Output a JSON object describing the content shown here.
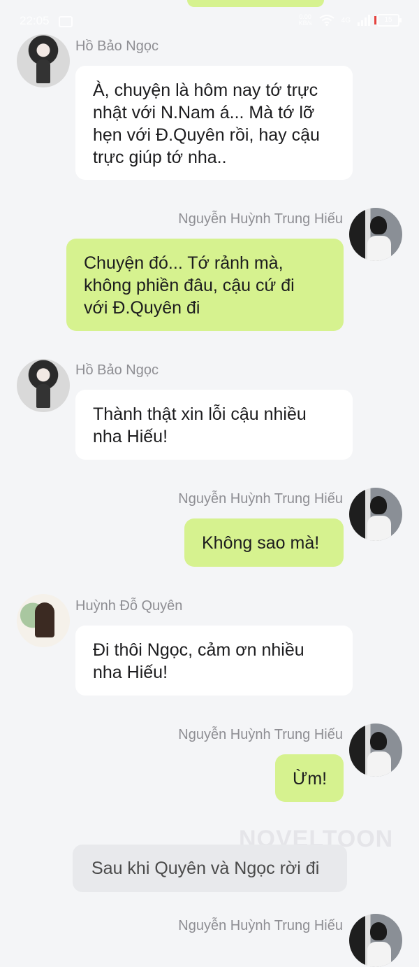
{
  "status_bar": {
    "time": "22:05",
    "net_speed": "0.00\nKB/s",
    "signal": "4G",
    "battery": "15"
  },
  "messages": [
    {
      "sender": "Hồ Bảo Ngọc",
      "text": "À, chuyện là hôm nay tớ trực\nnhật với N.Nam á... Mà tớ lỡ\nhẹn với Đ.Quyên rồi, hay cậu\ntrực giúp tớ nha.."
    },
    {
      "sender": "Nguyễn Huỳnh Trung Hiếu",
      "text": "Chuyện đó... Tớ rảnh mà,\nkhông phiền đâu, cậu cứ đi\nvới Đ.Quyên đi"
    },
    {
      "sender": "Hồ Bảo Ngọc",
      "text": "Thành thật xin lỗi cậu nhiều\nnha Hiếu!"
    },
    {
      "sender": "Nguyễn Huỳnh Trung Hiếu",
      "text": "Không sao mà!"
    },
    {
      "sender": "Huỳnh Đỗ Quyên",
      "text": "Đi thôi Ngọc, cảm ơn nhiều\nnha Hiếu!"
    },
    {
      "sender": "Nguyễn Huỳnh Trung Hiếu",
      "text": "Ừm!"
    }
  ],
  "narration": {
    "text": "Sau khi Quyên và Ngọc rời đi"
  },
  "trailing_sender": "Nguyễn Huỳnh Trung Hiếu",
  "watermark": "NOVELTOON",
  "colors": {
    "background": "#f4f5f7",
    "right_bubble": "#d6f28f",
    "left_bubble": "#ffffff",
    "narration_bubble": "#e8e9ec",
    "name_text": "#8e8e93"
  }
}
